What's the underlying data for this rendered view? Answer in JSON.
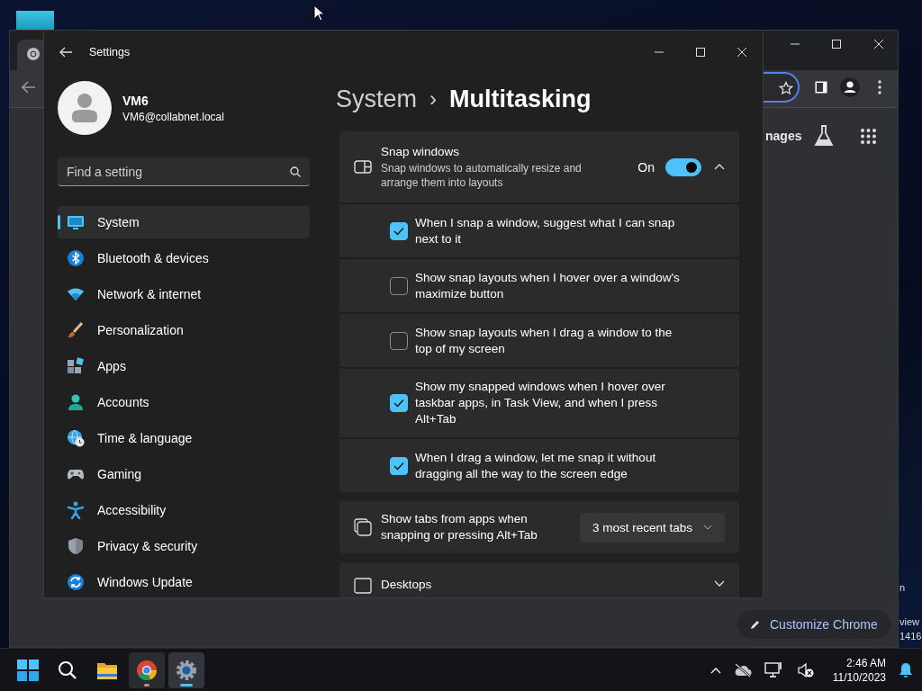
{
  "desktop": {
    "edge_text": [
      "n",
      "view",
      "1416"
    ]
  },
  "browser": {
    "toolbar_text": "nages",
    "customize_button": "Customize Chrome"
  },
  "settings": {
    "title": "Settings",
    "account": {
      "name": "VM6",
      "email": "VM6@collabnet.local"
    },
    "search": {
      "placeholder": "Find a setting"
    },
    "nav": [
      {
        "label": "System",
        "selected": true
      },
      {
        "label": "Bluetooth & devices",
        "selected": false
      },
      {
        "label": "Network & internet",
        "selected": false
      },
      {
        "label": "Personalization",
        "selected": false
      },
      {
        "label": "Apps",
        "selected": false
      },
      {
        "label": "Accounts",
        "selected": false
      },
      {
        "label": "Time & language",
        "selected": false
      },
      {
        "label": "Gaming",
        "selected": false
      },
      {
        "label": "Accessibility",
        "selected": false
      },
      {
        "label": "Privacy & security",
        "selected": false
      },
      {
        "label": "Windows Update",
        "selected": false
      }
    ],
    "breadcrumb": {
      "parent": "System",
      "separator": "›",
      "current": "Multitasking"
    },
    "snap": {
      "title": "Snap windows",
      "description": "Snap windows to automatically resize and arrange them into layouts",
      "state_label": "On",
      "on": true,
      "expanded": true,
      "options": [
        {
          "label": "When I snap a window, suggest what I can snap next to it",
          "checked": true
        },
        {
          "label": "Show snap layouts when I hover over a window's maximize button",
          "checked": false
        },
        {
          "label": "Show snap layouts when I drag a window to the top of my screen",
          "checked": false
        },
        {
          "label": "Show my snapped windows when I hover over taskbar apps, in Task View, and when I press Alt+Tab",
          "checked": true
        },
        {
          "label": "When I drag a window, let me snap it without dragging all the way to the screen edge",
          "checked": true
        }
      ]
    },
    "tabs_setting": {
      "label": "Show tabs from apps when snapping or pressing Alt+Tab",
      "value": "3 most recent tabs"
    },
    "desktops": {
      "label": "Desktops",
      "expanded": false
    }
  },
  "taskbar": {
    "apps": [
      {
        "kind": "start",
        "running": false
      },
      {
        "kind": "search",
        "running": false
      },
      {
        "kind": "explorer",
        "running": false
      },
      {
        "kind": "chrome",
        "running": true,
        "active": false
      },
      {
        "kind": "settings",
        "running": true,
        "active": true
      }
    ],
    "clock": {
      "time": "2:46 AM",
      "date": "11/10/2023"
    }
  }
}
